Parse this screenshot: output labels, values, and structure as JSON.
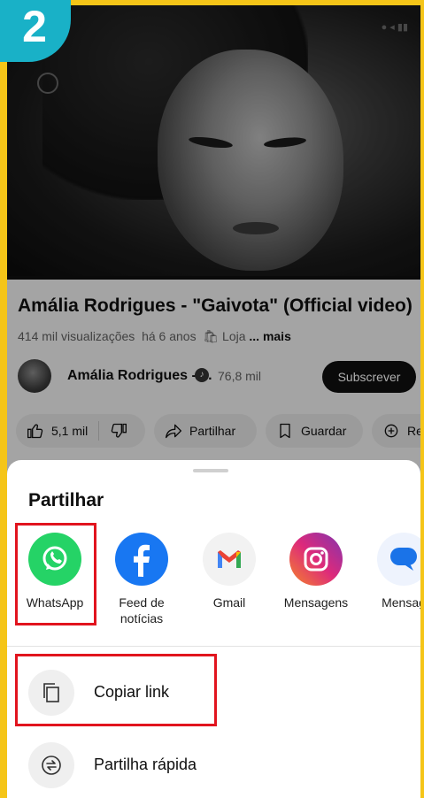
{
  "badge": {
    "number": "2"
  },
  "video": {
    "title": "Amália Rodrigues - \"Gaivota\" (Official video)"
  },
  "meta": {
    "views": "414 mil visualizações",
    "age": "há 6 anos",
    "store": "Loja",
    "more": "... mais"
  },
  "channel": {
    "name": "Amália Rodrigues - ...",
    "subscribers": "76,8 mil",
    "subscribe_label": "Subscrever"
  },
  "actions": [
    {
      "label": "5,1 mil",
      "icon": "thumb-up-icon"
    },
    {
      "label": "Partilhar",
      "icon": "share-icon"
    },
    {
      "label": "Guardar",
      "icon": "bookmark-icon"
    },
    {
      "label": "Rem",
      "icon": "remix-icon"
    }
  ],
  "share_sheet": {
    "title": "Partilhar",
    "apps": [
      {
        "label": "WhatsApp",
        "icon": "whatsapp-icon",
        "color": "#25d366"
      },
      {
        "label": "Feed de notícias",
        "icon": "facebook-icon",
        "color": "#1877f2"
      },
      {
        "label": "Gmail",
        "icon": "gmail-icon",
        "color": "#f2f2f2"
      },
      {
        "label": "Mensagens",
        "icon": "instagram-icon",
        "color": "#e1306c"
      },
      {
        "label": "Mensag",
        "icon": "messages-icon",
        "color": "#1a73e8"
      }
    ],
    "rows": [
      {
        "label": "Copiar link",
        "icon": "copy-icon"
      },
      {
        "label": "Partilha rápida",
        "icon": "quick-share-icon"
      }
    ]
  },
  "colors": {
    "highlight": "#e1141e",
    "badge": "#19b1c7",
    "background": "#f5c518"
  }
}
